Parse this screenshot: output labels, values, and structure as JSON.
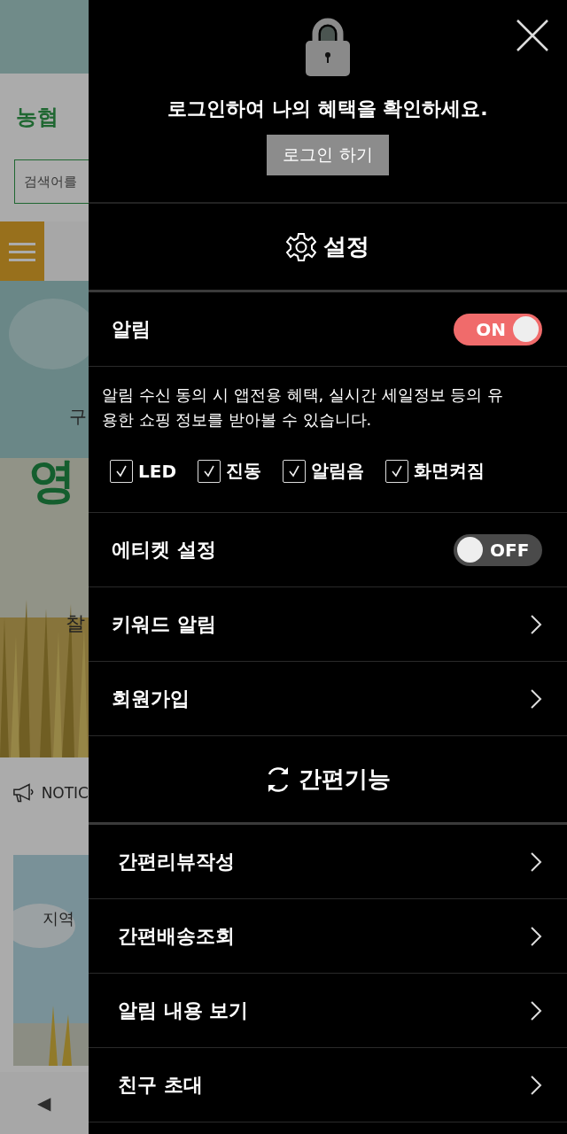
{
  "background_page": {
    "logo": "농협",
    "search": {
      "placeholder": "검색어를"
    },
    "hero": {
      "texts": [
        "구",
        "영",
        "찰"
      ]
    },
    "notice": {
      "label": "NOTIC"
    },
    "card": {
      "caption": "지역"
    },
    "nav": {
      "back": "◀"
    }
  },
  "drawer": {
    "login_prompt": "로그인하여 나의 혜택을 확인하세요.",
    "login_button": "로그인 하기",
    "settings_title": "설정",
    "toggles": [
      {
        "label": "알림",
        "on": true,
        "state_label": "ON"
      }
    ],
    "description": "알림 수신 동의 시 앱전용 혜택, 실시간 세일정보 등의 유용한 쇼핑 정보를 받아볼 수 있습니다.",
    "options": [
      {
        "label": "LED",
        "checked": true
      },
      {
        "label": "진동",
        "checked": true
      },
      {
        "label": "알림음",
        "checked": true
      },
      {
        "label": "화면켜짐",
        "checked": true
      }
    ],
    "etiquette": {
      "label": "에티켓 설정",
      "on": false,
      "state_label": "OFF"
    },
    "links": [
      "키워드 알림",
      "회원가입"
    ],
    "quick_title": "간편기능",
    "quick_items": [
      "간편리뷰작성",
      "간편배송조회",
      "알림 내용 보기",
      "친구 초대"
    ]
  }
}
